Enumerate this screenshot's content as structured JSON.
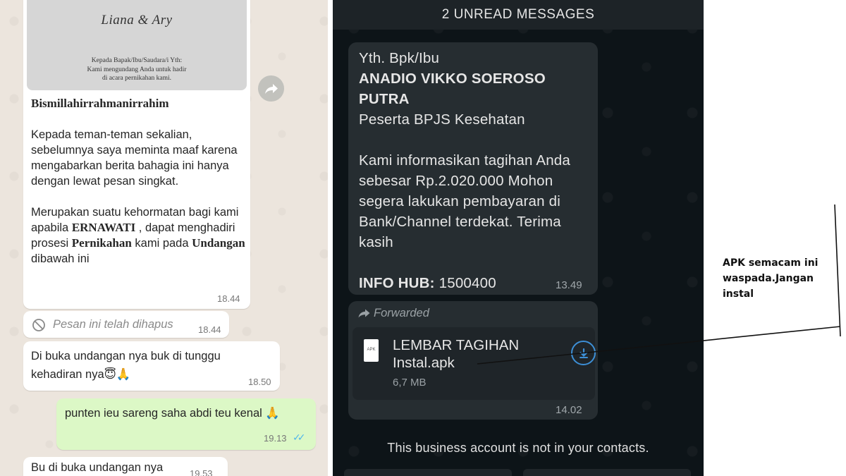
{
  "left_chat": {
    "invite_card": {
      "names": "Liana & Ary",
      "line1": "Kepada Bapak/Ibu/Saudara/i Yth:",
      "line2": "Kami mengundang Anda untuk hadir",
      "line3": "di acara pernikahan kami."
    },
    "invite_message": {
      "heading": "Bismillahirrahmanirrahim",
      "para1": "Kepada teman-teman sekalian, sebelumnya saya meminta maaf karena mengabarkan berita bahagia ini hanya dengan lewat pesan singkat.",
      "para2_pre": "Merupakan suatu kehormatan bagi kami apabila ",
      "para2_name": "ERNAWATI",
      "para2_mid": " , dapat menghadiri prosesi ",
      "para2_event": "Pernikahan",
      "para2_mid2": " kami pada ",
      "para2_invite": "Undangan",
      "para2_post": " dibawah ini",
      "time": "18.44"
    },
    "deleted_message": {
      "text": "Pesan ini telah dihapus",
      "time": "18.44"
    },
    "open_message": {
      "text": "Di buka undangan nya buk di tunggu kehadiran nya😇🙏",
      "time": "18.50"
    },
    "reply_message": {
      "text": "punten ieu sareng saha abdi teu kenal 🙏",
      "time": "19.13",
      "ticks": "✓✓"
    },
    "last_message": {
      "text": "Bu di buka undangan nya",
      "time": "19.53"
    }
  },
  "center_chat": {
    "unread_banner": "2 UNREAD MESSAGES",
    "bpjs_message": {
      "greeting": "Yth. Bpk/Ibu",
      "name": "ANADIO VIKKO SOEROSO PUTRA",
      "role": "Peserta BPJS Kesehatan",
      "body": "Kami informasikan tagihan Anda sebesar Rp.2.020.000 Mohon segera lakukan pembayaran di Bank/Channel terdekat. Terima kasih",
      "info_label": "INFO HUB:",
      "info_value": " 1500400",
      "time": "13.49"
    },
    "apk_message": {
      "forwarded": "Forwarded",
      "file_type": "APK",
      "file_name": "LEMBAR TAGIHAN Instal.apk",
      "file_size": "6,7 MB",
      "time": "14.02"
    },
    "business_notice": "This business account is not in your contacts."
  },
  "annotation": {
    "text": "APK semacam ini waspada.Jangan instal"
  },
  "colors": {
    "left_bg": "#ece5dd",
    "outgoing_bubble": "#dcf8c6",
    "dark_bg": "#0d1418",
    "dark_bubble": "#262d31",
    "download_blue": "#3d8fd6",
    "read_tick_blue": "#4fb6ec"
  }
}
